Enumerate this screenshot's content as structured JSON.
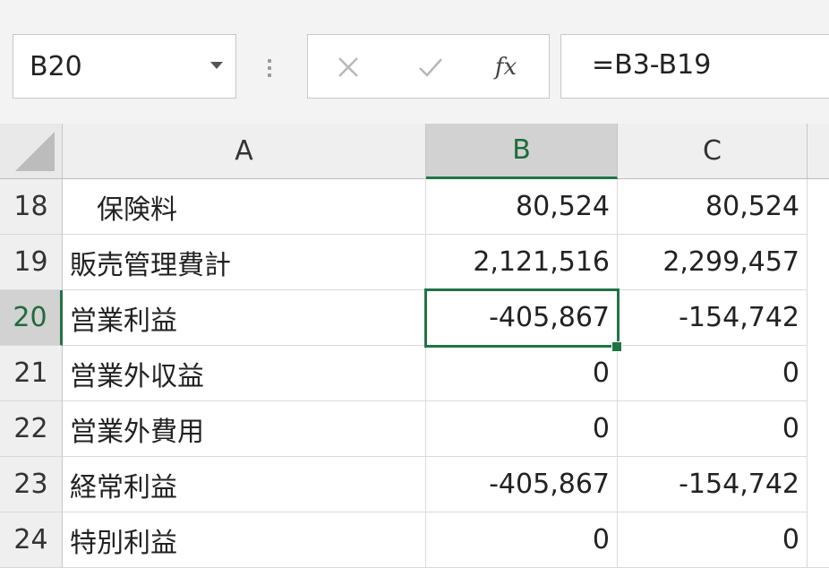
{
  "name_box": {
    "value": "B20"
  },
  "formula_bar": {
    "cancel_icon": "close-icon",
    "enter_icon": "check-icon",
    "fx_label": "fx",
    "formula": "=B3-B19"
  },
  "columns": [
    "A",
    "B",
    "C"
  ],
  "selected_column": "B",
  "selected_row": "20",
  "rows": [
    {
      "row": "18",
      "label": "　保険料",
      "b": "80,524",
      "c": "80,524"
    },
    {
      "row": "19",
      "label": "販売管理費計",
      "b": "2,121,516",
      "c": "2,299,457"
    },
    {
      "row": "20",
      "label": "営業利益",
      "b": "-405,867",
      "c": "-154,742"
    },
    {
      "row": "21",
      "label": "営業外収益",
      "b": "0",
      "c": "0"
    },
    {
      "row": "22",
      "label": "営業外費用",
      "b": "0",
      "c": "0"
    },
    {
      "row": "23",
      "label": "経常利益",
      "b": "-405,867",
      "c": "-154,742"
    },
    {
      "row": "24",
      "label": "特別利益",
      "b": "0",
      "c": "0"
    }
  ],
  "colors": {
    "accent": "#217346",
    "header_bg": "#efefef",
    "header_selected_bg": "#d2d2d2"
  }
}
